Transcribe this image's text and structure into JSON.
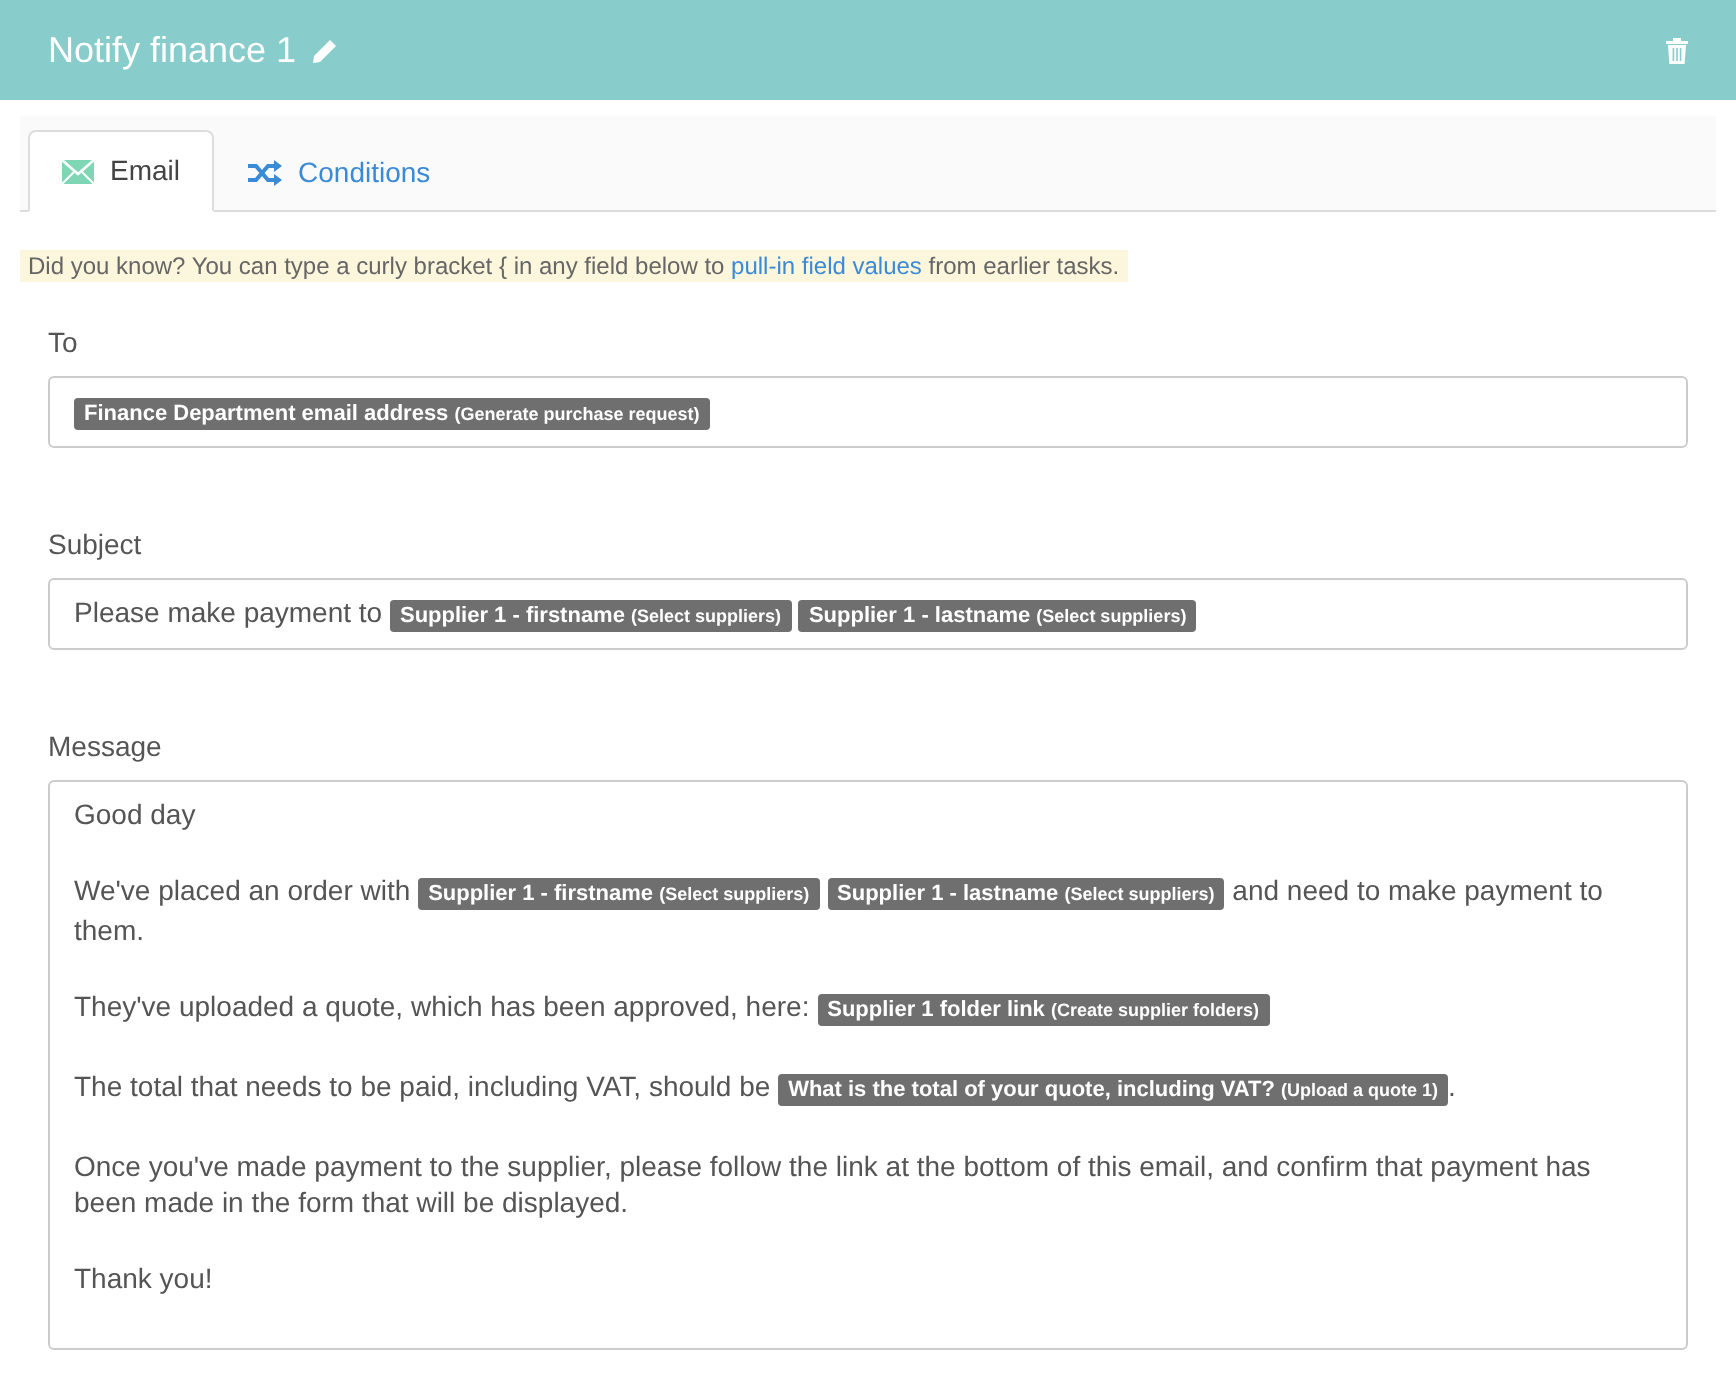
{
  "header": {
    "title": "Notify finance 1"
  },
  "tabs": [
    {
      "label": "Email",
      "selected": true
    },
    {
      "label": "Conditions",
      "selected": false
    }
  ],
  "hint": [
    {
      "kind": "text",
      "text": "Did you know? You can type a curly bracket { in any field below to "
    },
    {
      "kind": "link",
      "text": "pull-in field values"
    },
    {
      "kind": "text",
      "text": " from earlier tasks."
    }
  ],
  "fields": [
    {
      "label": "To",
      "paragraphs": [
        [
          {
            "kind": "token",
            "text": "Finance Department email address",
            "source": "(Generate purchase request)"
          }
        ]
      ]
    },
    {
      "label": "Subject",
      "paragraphs": [
        [
          {
            "kind": "text",
            "text": "Please make payment to"
          },
          {
            "kind": "token",
            "text": "Supplier 1 - firstname",
            "source": "(Select suppliers)"
          },
          {
            "kind": "token",
            "text": "Supplier 1 - lastname",
            "source": "(Select suppliers)"
          }
        ]
      ]
    },
    {
      "label": "Message",
      "paragraphs": [
        [
          {
            "kind": "text",
            "text": "Good day"
          }
        ],
        [
          {
            "kind": "text",
            "text": "We've placed an order with"
          },
          {
            "kind": "token",
            "text": "Supplier 1 - firstname",
            "source": "(Select suppliers)"
          },
          {
            "kind": "token",
            "text": "Supplier 1 - lastname",
            "source": "(Select suppliers)"
          },
          {
            "kind": "text",
            "text": "and need to make payment to"
          },
          {
            "kind": "wrapped",
            "text": "them."
          }
        ],
        [
          {
            "kind": "text",
            "text": "They've uploaded a quote, which has been approved, here:"
          },
          {
            "kind": "token",
            "text": "Supplier 1 folder link",
            "source": "(Create supplier folders)"
          }
        ],
        [
          {
            "kind": "text",
            "text": "The total that needs to be paid, including VAT, should be"
          },
          {
            "kind": "token",
            "text": "What is the total of your quote, including VAT?",
            "source": "(Upload a quote 1)"
          },
          {
            "kind": "punct",
            "text": "."
          }
        ],
        [
          {
            "kind": "text",
            "text": "Once you've made payment to the supplier, please follow the link at the bottom of this email, and confirm that payment has been made in the form that will be displayed."
          }
        ],
        [
          {
            "kind": "text",
            "text": "Thank you!"
          }
        ]
      ]
    }
  ]
}
